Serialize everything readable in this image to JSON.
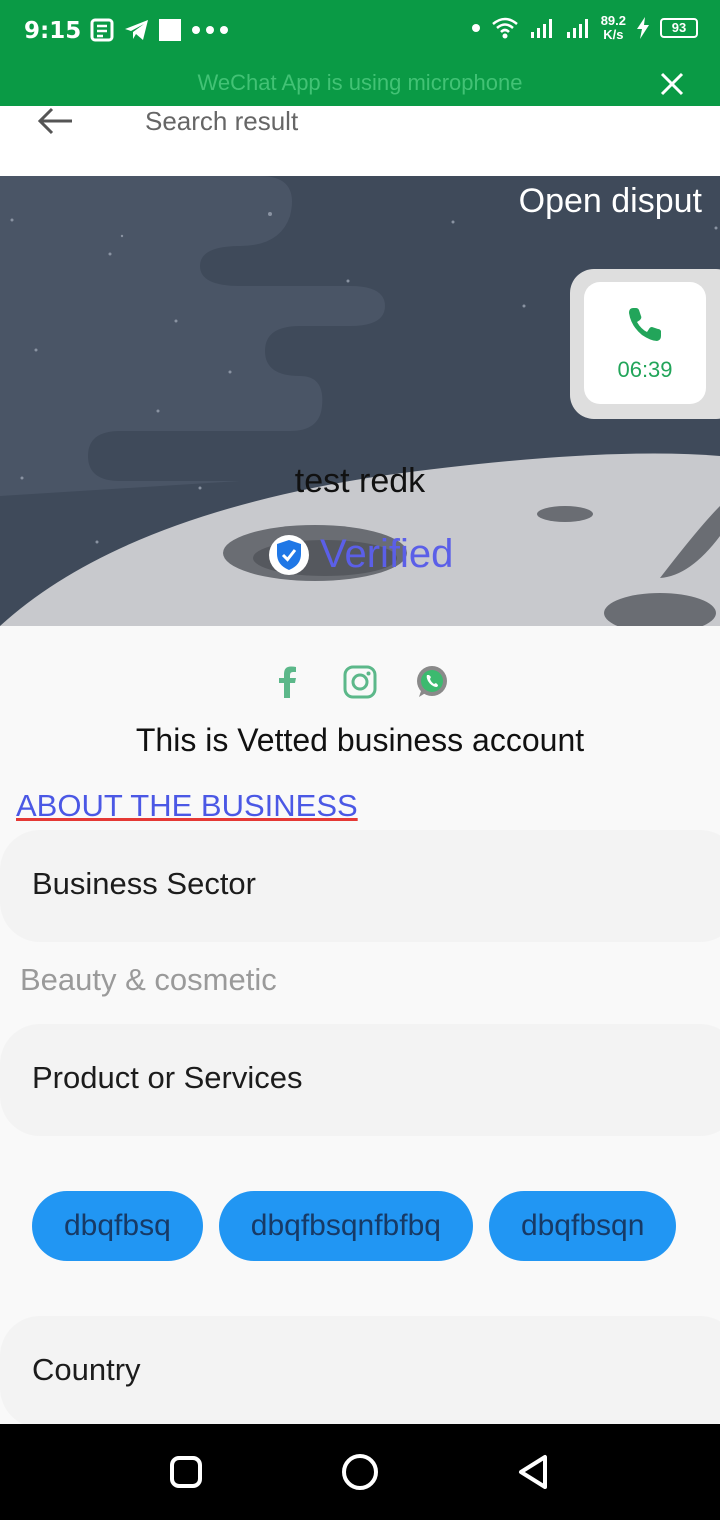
{
  "status_bar": {
    "time": "9:15",
    "net_speed_value": "89.2",
    "net_speed_unit": "K/s",
    "battery": "93",
    "bg_color": "#0a9a45"
  },
  "mic_banner": {
    "text": "WeChat App is using microphone"
  },
  "app_bar": {
    "title": "Search result"
  },
  "hero": {
    "open_dispute": "Open disput",
    "call_timer": "06:39",
    "business_name": "test redk",
    "verified_label": "Verified"
  },
  "socials": {
    "icons": [
      "facebook-icon",
      "instagram-icon",
      "whatsapp-icon"
    ]
  },
  "vetted_text": "This is Vetted business account",
  "about_link": "ABOUT THE BUSINESS",
  "sections": {
    "business_sector": {
      "title": "Business Sector",
      "value": "Beauty & cosmetic"
    },
    "products": {
      "title": "Product or Services",
      "chips": [
        "dbqfbsq",
        "dbqfbsqnfbfbq",
        "dbqfbsqn"
      ]
    },
    "country": {
      "title": "Country"
    }
  },
  "colors": {
    "accent_green": "#22a55a",
    "verified_blue": "#5b5fe8",
    "chip_blue": "#2196f3"
  }
}
